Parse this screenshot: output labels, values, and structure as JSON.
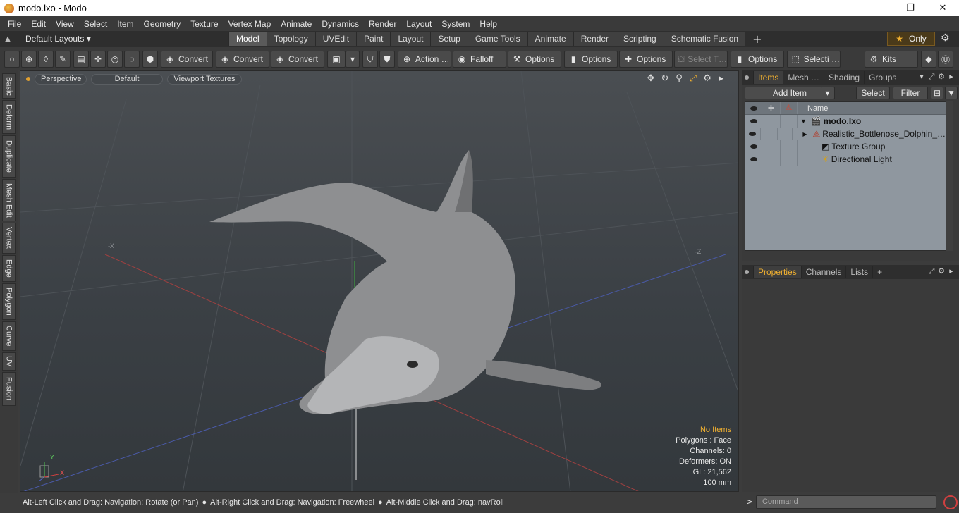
{
  "window": {
    "title": "modo.lxo - Modo",
    "minimize": "—",
    "maximize": "❐",
    "close": "✕"
  },
  "menu": [
    "File",
    "Edit",
    "View",
    "Select",
    "Item",
    "Geometry",
    "Texture",
    "Vertex Map",
    "Animate",
    "Dynamics",
    "Render",
    "Layout",
    "System",
    "Help"
  ],
  "layoutbar": {
    "layouts_label": "Default Layouts ▾",
    "tabs": [
      "Model",
      "Topology",
      "UVEdit",
      "Paint",
      "Layout",
      "Setup",
      "Game Tools",
      "Animate",
      "Render",
      "Scripting",
      "Schematic Fusion"
    ],
    "active_tab": "Model",
    "only_label": "Only"
  },
  "toolbar": {
    "convert1": "Convert",
    "convert2": "Convert",
    "convert3": "Convert",
    "action": "Action …",
    "falloff": "Falloff",
    "options1": "Options",
    "options2": "Options",
    "options3": "Options",
    "select_t": "Select T…",
    "options4": "Options",
    "selecti": "Selecti …",
    "kits": "Kits"
  },
  "left_tabs": [
    "Basic",
    "Deform",
    "Duplicate",
    "Mesh Edit",
    "Vertex",
    "Edge",
    "Polygon",
    "Curve",
    "UV",
    "Fusion"
  ],
  "viewport": {
    "view": "Perspective",
    "style": "Default",
    "shading": "Viewport Textures",
    "axis_x": "-X",
    "axis_z": "-Z",
    "stats": {
      "items": "No Items",
      "polygons": "Polygons : Face",
      "channels": "Channels: 0",
      "deformers": "Deformers: ON",
      "gl": "GL: 21,562",
      "unit": "100 mm"
    },
    "gizmo_y": "Y",
    "gizmo_x": "X"
  },
  "status": {
    "hint1": "Alt-Left Click and Drag: Navigation: Rotate (or Pan)",
    "hint2": "Alt-Right Click and Drag: Navigation: Freewheel",
    "hint3": "Alt-Middle Click and Drag: navRoll"
  },
  "items_panel": {
    "tabs": [
      "Items",
      "Mesh …",
      "Shading",
      "Groups"
    ],
    "active_tab": "Items",
    "add_item": "Add Item",
    "select": "Select",
    "filter": "Filter",
    "name_header": "Name",
    "rows": [
      {
        "name": "modo.lxo"
      },
      {
        "name": "Realistic_Bottlenose_Dolphin_…"
      },
      {
        "name": "Texture Group"
      },
      {
        "name": "Directional Light"
      }
    ]
  },
  "props_panel": {
    "tabs": [
      "Properties",
      "Channels",
      "Lists"
    ],
    "active_tab": "Properties"
  },
  "command": {
    "placeholder": "Command",
    "prompt": ">"
  },
  "colors": {
    "accent": "#f0b030",
    "tree_bg": "#8f979f"
  }
}
